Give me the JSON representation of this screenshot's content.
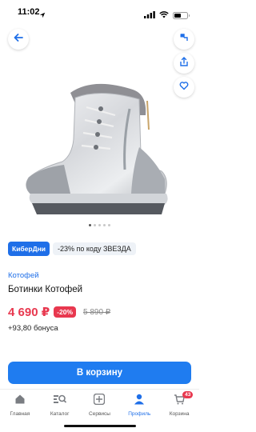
{
  "status_bar": {
    "time": "11:02"
  },
  "promo": {
    "badge": "КиберДни",
    "text": "-23% по коду ЗВЕЗДА"
  },
  "product": {
    "seller": "Котофей",
    "title": "Ботинки Котофей",
    "price": "4 690 ₽",
    "discount": "-20%",
    "old_price": "5 890 ₽",
    "bonus": "+93,80 бонуса"
  },
  "gallery": {
    "dots": 5,
    "active_dot": 0
  },
  "cart_button": {
    "label": "В корзину"
  },
  "tabbar": {
    "items": [
      {
        "label": "Главная",
        "icon": "home-icon"
      },
      {
        "label": "Каталог",
        "icon": "catalog-search-icon"
      },
      {
        "label": "Сервисы",
        "icon": "services-icon"
      },
      {
        "label": "Профиль",
        "icon": "profile-icon"
      },
      {
        "label": "Корзина",
        "icon": "cart-icon",
        "badge": "43"
      }
    ]
  },
  "colors": {
    "accent": "#1f7cf0",
    "price": "#e8384f"
  }
}
